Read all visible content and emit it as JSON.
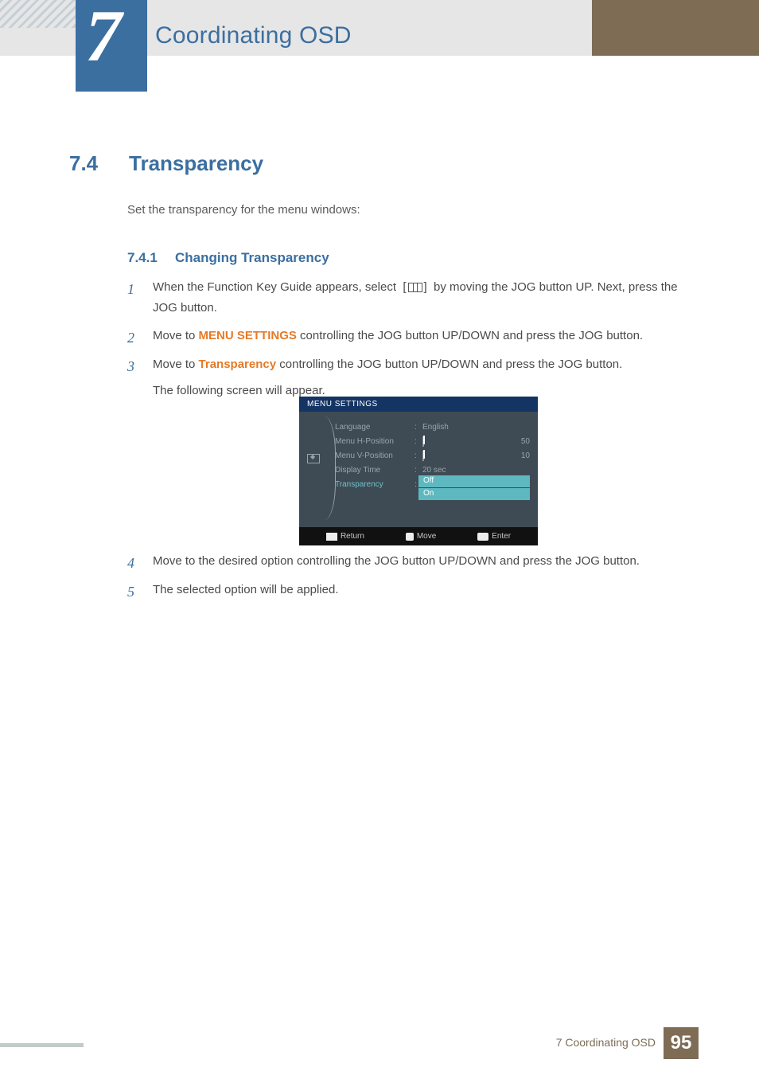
{
  "chapter": {
    "number": "7",
    "title": "Coordinating OSD"
  },
  "section": {
    "number": "7.4",
    "title": "Transparency"
  },
  "intro": "Set the transparency for the menu windows:",
  "subsection": {
    "number": "7.4.1",
    "title": "Changing Transparency"
  },
  "steps": {
    "s1_a": "When the Function Key Guide appears, select",
    "s1_b": "by moving the JOG button UP. Next, press the JOG button.",
    "s2_a": "Move to",
    "s2_kw": "MENU SETTINGS",
    "s2_b": "controlling the JOG button UP/DOWN and press the JOG button.",
    "s3_a": "Move to",
    "s3_kw": "Transparency",
    "s3_b": "controlling the JOG button UP/DOWN and press the JOG button.",
    "s3_c": "The following screen will appear.",
    "s4": "Move to the desired option controlling the JOG button UP/DOWN and press the JOG button.",
    "s5": "The selected option will be applied."
  },
  "osd": {
    "header": "MENU SETTINGS",
    "rows": {
      "language": {
        "label": "Language",
        "value": "English"
      },
      "hpos": {
        "label": "Menu H-Position",
        "value": "50"
      },
      "vpos": {
        "label": "Menu V-Position",
        "value": "10"
      },
      "dtime": {
        "label": "Display Time",
        "value": "20 sec"
      },
      "trans": {
        "label": "Transparency"
      }
    },
    "choices": {
      "off": "Off",
      "on": "On"
    },
    "footer": {
      "return": "Return",
      "move": "Move",
      "enter": "Enter"
    }
  },
  "footer": {
    "label": "7 Coordinating OSD",
    "page": "95"
  }
}
